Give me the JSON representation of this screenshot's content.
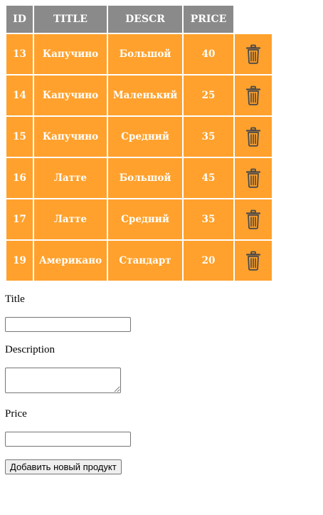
{
  "table": {
    "headers": {
      "id": "ID",
      "title": "TITLE",
      "descr": "DESCR",
      "price": "PRICE"
    },
    "rows": [
      {
        "id": "13",
        "title": "Капучино",
        "descr": "Большой",
        "price": "40",
        "delete_icon": "trash-icon"
      },
      {
        "id": "14",
        "title": "Капучино",
        "descr": "Маленький",
        "price": "25",
        "delete_icon": "trash-icon"
      },
      {
        "id": "15",
        "title": "Капучино",
        "descr": "Средний",
        "price": "35",
        "delete_icon": "trash-icon"
      },
      {
        "id": "16",
        "title": "Латте",
        "descr": "Большой",
        "price": "45",
        "delete_icon": "trash-icon"
      },
      {
        "id": "17",
        "title": "Латте",
        "descr": "Средний",
        "price": "35",
        "delete_icon": "trash-icon"
      },
      {
        "id": "19",
        "title": "Американо",
        "descr": "Стандарт",
        "price": "20",
        "delete_icon": "trash-icon"
      }
    ],
    "header_color": "#8a8a8a",
    "row_color": "#ffa12c",
    "icon_color": "#4a4a4a"
  },
  "form": {
    "title_label": "Title",
    "title_value": "",
    "description_label": "Description",
    "description_value": "",
    "price_label": "Price",
    "price_value": "",
    "submit_label": "Добавить новый продукт"
  }
}
